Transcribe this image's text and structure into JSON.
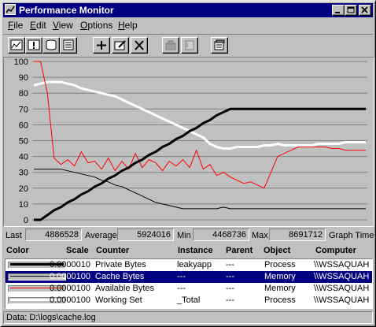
{
  "window": {
    "title": "Performance Monitor"
  },
  "menu": [
    {
      "label": "File",
      "key": "F",
      "rest": "ile"
    },
    {
      "label": "Edit",
      "key": "E",
      "rest": "dit"
    },
    {
      "label": "View",
      "key": "V",
      "rest": "iew"
    },
    {
      "label": "Options",
      "key": "O",
      "rest": "ptions"
    },
    {
      "label": "Help",
      "key": "H",
      "rest": "elp"
    }
  ],
  "toolbar": {
    "buttons": [
      "chart-view-icon",
      "alert-view-icon",
      "log-view-icon",
      "report-view-icon",
      "add-counter-icon",
      "edit-counter-icon",
      "delete-counter-icon",
      "update-now-icon",
      "bookmark-icon",
      "options-icon"
    ]
  },
  "chart_data": {
    "type": "line",
    "ylim": [
      0,
      100
    ],
    "y_ticks": [
      "100",
      "90",
      "80",
      "70",
      "60",
      "50",
      "40",
      "30",
      "20",
      "10",
      "0"
    ],
    "x_points": 50,
    "series": [
      {
        "name": "Private Bytes",
        "color": "#000000",
        "width": 3,
        "values": [
          0,
          0,
          3,
          6,
          8,
          11,
          13,
          16,
          18,
          21,
          23,
          26,
          28,
          31,
          33,
          36,
          38,
          41,
          43,
          46,
          48,
          51,
          53,
          56,
          58,
          61,
          63,
          66,
          68,
          70,
          70,
          70,
          70,
          70,
          70,
          70,
          70,
          70,
          70,
          70,
          70,
          70,
          70,
          70,
          70,
          70,
          70,
          70,
          70,
          70
        ]
      },
      {
        "name": "Cache Bytes",
        "color": "#000000",
        "width": 1,
        "values": [
          32,
          32,
          32,
          32,
          32,
          31,
          30,
          29,
          28,
          27,
          25,
          24,
          22,
          21,
          19,
          17,
          15,
          13,
          11,
          10,
          9,
          8,
          7,
          7,
          7,
          7,
          7,
          7,
          8,
          7,
          7,
          7,
          7,
          7,
          7,
          7,
          7,
          7,
          7,
          7,
          7,
          7,
          7,
          7,
          7,
          7,
          7,
          7,
          7,
          7
        ]
      },
      {
        "name": "Available Bytes",
        "color": "#ff0000",
        "width": 1,
        "values": [
          100,
          100,
          80,
          39,
          35,
          38,
          34,
          43,
          36,
          37,
          32,
          39,
          31,
          37,
          32,
          42,
          33,
          38,
          36,
          31,
          37,
          34,
          38,
          33,
          44,
          32,
          35,
          28,
          30,
          27,
          25,
          23,
          24,
          22,
          20,
          30,
          40,
          42,
          44,
          46,
          46,
          46,
          46,
          46,
          45,
          45,
          44,
          44,
          44,
          44
        ]
      },
      {
        "name": "Working Set",
        "color": "#ffffff",
        "width": 3,
        "values": [
          85,
          86,
          87,
          87,
          87,
          86,
          85,
          83,
          82,
          81,
          80,
          79,
          78,
          76,
          74,
          72,
          70,
          68,
          66,
          64,
          62,
          60,
          58,
          56,
          54,
          52,
          48,
          46,
          45,
          45,
          46,
          46,
          46,
          46,
          47,
          47,
          48,
          47,
          47,
          47,
          47,
          47,
          48,
          48,
          48,
          48,
          49,
          49,
          49,
          49
        ]
      }
    ]
  },
  "stats": {
    "last_label": "Last",
    "last_value": "4886528",
    "average_label": "Average",
    "average_value": "5924016",
    "min_label": "Min",
    "min_value": "4468736",
    "max_label": "Max",
    "max_value": "8691712",
    "graph_time_label": "Graph Time"
  },
  "legend": {
    "headers": {
      "color": "Color",
      "scale": "Scale",
      "counter": "Counter",
      "instance": "Instance",
      "parent": "Parent",
      "object": "Object",
      "computer": "Computer"
    },
    "rows": [
      {
        "color": "#000000",
        "thick": true,
        "scale": "0.0000010",
        "counter": "Private Bytes",
        "instance": "leakyapp",
        "parent": "---",
        "object": "Process",
        "computer": "\\\\WSSAQUAH",
        "selected": false
      },
      {
        "color": "#000000",
        "thick": false,
        "scale": "0.0000100",
        "counter": "Cache Bytes",
        "instance": "---",
        "parent": "---",
        "object": "Memory",
        "computer": "\\\\WSSAQUAH",
        "selected": true
      },
      {
        "color": "#ff0000",
        "thick": false,
        "scale": "0.0000100",
        "counter": "Available Bytes",
        "instance": "---",
        "parent": "---",
        "object": "Memory",
        "computer": "\\\\WSSAQUAH",
        "selected": false
      },
      {
        "color": "#ffffff",
        "thick": true,
        "scale": "0.0000100",
        "counter": "Working Set",
        "instance": "_Total",
        "parent": "---",
        "object": "Process",
        "computer": "\\\\WSSAQUAH",
        "selected": false
      }
    ]
  },
  "status": {
    "text": "Data: D:\\logs\\cache.log"
  }
}
